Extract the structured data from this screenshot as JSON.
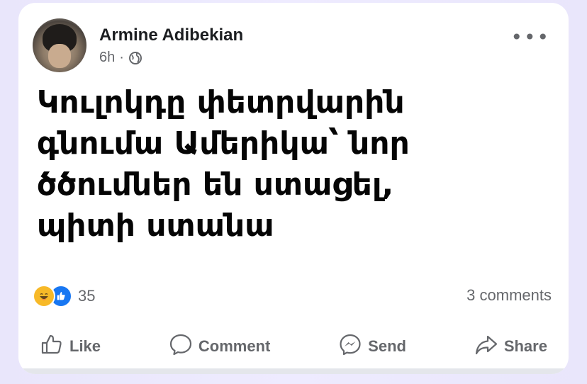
{
  "post": {
    "author": "Armine Adibekian",
    "time": "6h",
    "separator": "·",
    "text": "Կուլոկդը փետրվարին\nգնումա Ամերիկա՝ նոր\nծծումներ են ստացել,\nպիտի ստանա",
    "more_glyph": "•••"
  },
  "stats": {
    "reaction_count": "35",
    "comments_label": "3 comments"
  },
  "actions": {
    "like": "Like",
    "comment": "Comment",
    "send": "Send",
    "share": "Share"
  },
  "colors": {
    "accent_blue": "#1877f2",
    "haha_yellow": "#f7b928",
    "secondary_text": "#65676b"
  },
  "icons": [
    "globe-icon",
    "more-icon",
    "haha-reaction-icon",
    "like-reaction-icon",
    "like-icon",
    "comment-icon",
    "messenger-send-icon",
    "share-icon"
  ]
}
